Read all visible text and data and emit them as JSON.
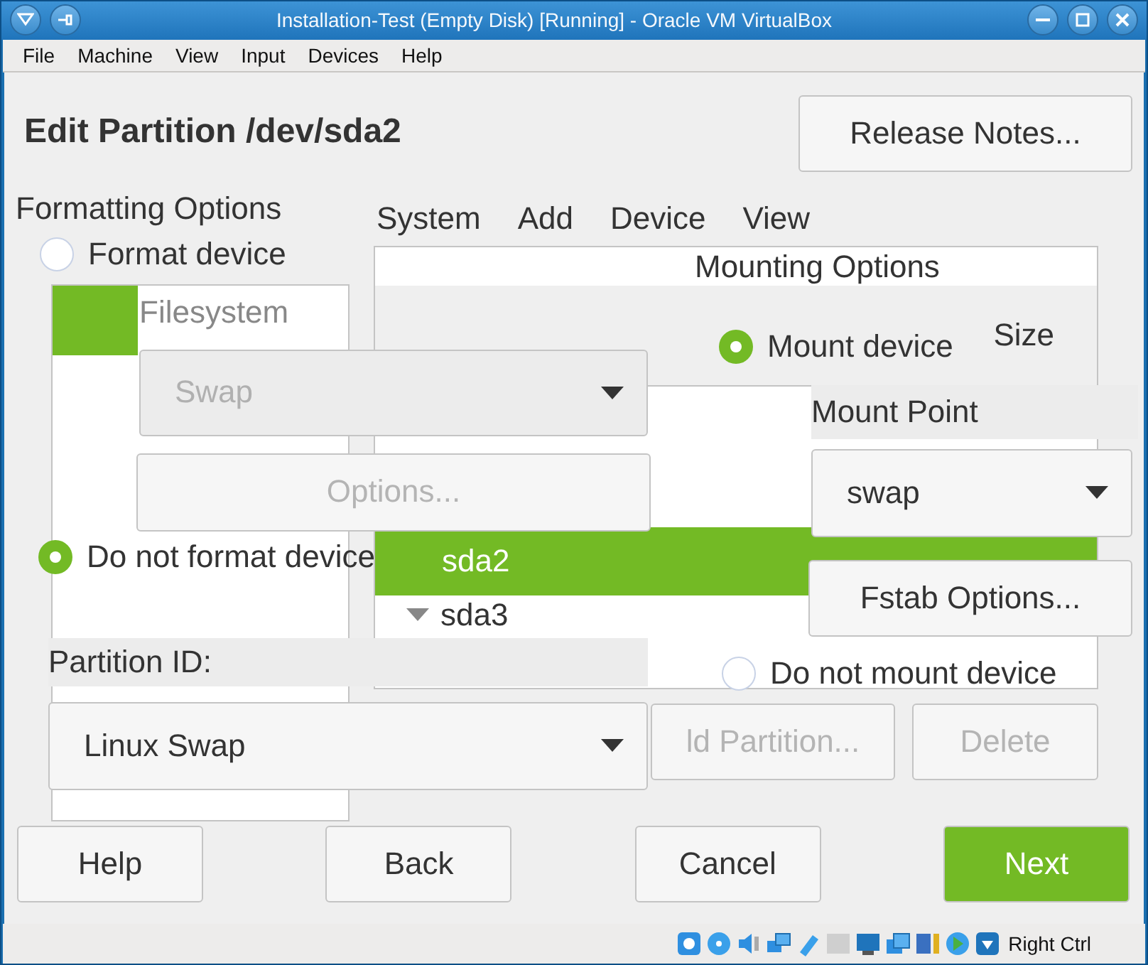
{
  "window": {
    "title": "Installation-Test (Empty Disk) [Running] - Oracle VM VirtualBox"
  },
  "menu": [
    "File",
    "Machine",
    "View",
    "Input",
    "Devices",
    "Help"
  ],
  "installer": {
    "heading": "Edit Partition /dev/sda2",
    "release_notes": "Release Notes...",
    "menu": [
      "System",
      "Add",
      "Device",
      "View"
    ],
    "table": {
      "size_header": "Size",
      "rows": [
        {
          "device": "sda2",
          "selected": true,
          "expanded": false
        },
        {
          "device": "sda3",
          "selected": false,
          "expanded": true
        }
      ]
    },
    "actions": [
      {
        "label": "ld Partition...",
        "disabled": true
      },
      {
        "label": "Delete",
        "disabled": true
      }
    ],
    "nav": [
      {
        "label": "Help",
        "kind": "plain"
      },
      {
        "label": "Back",
        "kind": "plain"
      },
      {
        "label": "Cancel",
        "kind": "plain"
      },
      {
        "label": "Next",
        "kind": "primary"
      }
    ]
  },
  "dialog": {
    "formatting": {
      "title": "Formatting Options",
      "options": [
        {
          "label": "Format device",
          "selected": false
        },
        {
          "label": "Do not format device",
          "selected": true
        }
      ],
      "filesystem_label": "Filesystem",
      "filesystem": {
        "value": "Swap",
        "disabled": true
      },
      "options_button": {
        "label": "Options...",
        "disabled": true
      },
      "partition_id_label": "Partition ID:",
      "partition_id": "Linux Swap"
    },
    "mounting": {
      "title": "Mounting Options",
      "options": [
        {
          "label": "Mount device",
          "selected": true
        },
        {
          "label": "Do not mount device",
          "selected": false
        }
      ],
      "mount_point_label": "Mount Point",
      "mount_point": "swap",
      "fstab_button": "Fstab Options..."
    }
  },
  "status_bar": {
    "hint": "Right Ctrl"
  }
}
